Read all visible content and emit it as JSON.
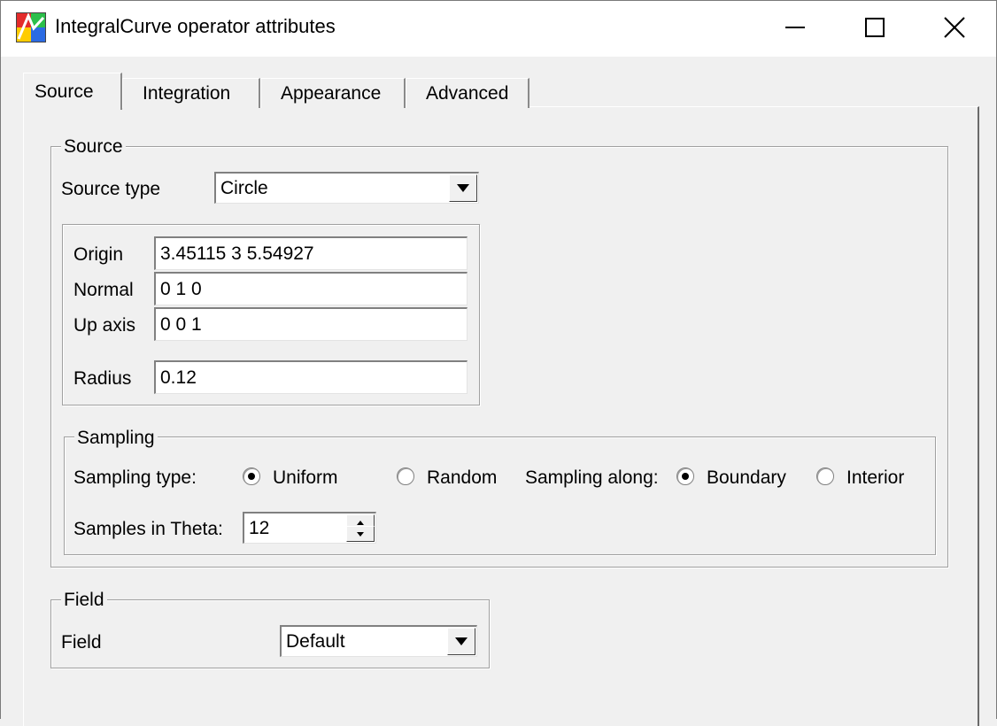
{
  "window": {
    "title": "IntegralCurve operator attributes",
    "icon": "visit-app-icon"
  },
  "tabs": [
    {
      "label": "Source",
      "active": true
    },
    {
      "label": "Integration",
      "active": false
    },
    {
      "label": "Appearance",
      "active": false
    },
    {
      "label": "Advanced",
      "active": false
    }
  ],
  "source_group": {
    "legend": "Source",
    "source_type_label": "Source type",
    "source_type_value": "Circle",
    "fields": {
      "origin_label": "Origin",
      "origin_value": "3.45115 3 5.54927",
      "normal_label": "Normal",
      "normal_value": "0 1 0",
      "up_axis_label": "Up axis",
      "up_axis_value": "0 0 1",
      "radius_label": "Radius",
      "radius_value": "0.12"
    }
  },
  "sampling_group": {
    "legend": "Sampling",
    "sampling_type_label": "Sampling type:",
    "uniform_label": "Uniform",
    "uniform_checked": true,
    "random_label": "Random",
    "random_checked": false,
    "sampling_along_label": "Sampling along:",
    "boundary_label": "Boundary",
    "boundary_checked": true,
    "interior_label": "Interior",
    "interior_checked": false,
    "samples_theta_label": "Samples in Theta:",
    "samples_theta_value": "12"
  },
  "field_group": {
    "legend": "Field",
    "field_label": "Field",
    "field_value": "Default"
  },
  "colors": {
    "background": "#f0f0f0",
    "titlebar": "#ffffff",
    "field_bg": "#ffffff"
  }
}
